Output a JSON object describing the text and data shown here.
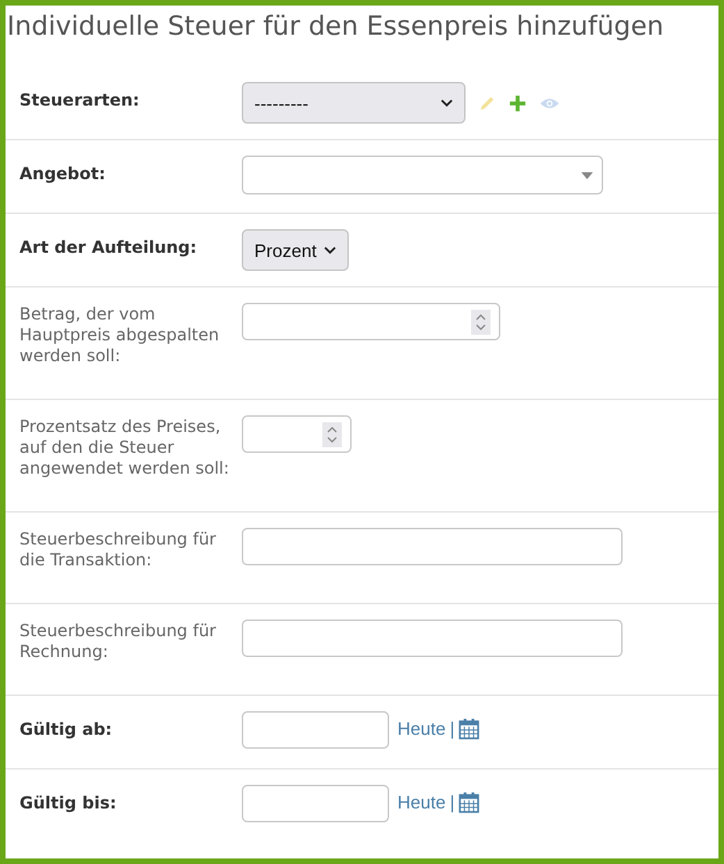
{
  "title": "Individuelle Steuer für den Essenpreis hinzufügen",
  "fields": [
    {
      "label": "Steuerarten:",
      "required": true,
      "kind": "select",
      "value": "---------",
      "actions": true
    },
    {
      "label": "Angebot:",
      "required": true,
      "kind": "combo"
    },
    {
      "label": "Art der Aufteilung:",
      "required": true,
      "kind": "small-select",
      "value": "Prozent"
    },
    {
      "label": "Betrag, der vom Hauptpreis abgespalten werden soll:",
      "required": false,
      "kind": "number"
    },
    {
      "label": "Prozentsatz des Preises, auf den die Steuer angewendet werden soll:",
      "required": false,
      "kind": "small-number"
    },
    {
      "label": "Steuerbeschreibung für die Transaktion:",
      "required": false,
      "kind": "text"
    },
    {
      "label": "Steuerbeschreibung für Rechnung:",
      "required": false,
      "kind": "text"
    },
    {
      "label": "Gültig ab:",
      "required": true,
      "kind": "date",
      "today": "Heute",
      "separator": "|"
    },
    {
      "label": "Gültig bis:",
      "required": true,
      "kind": "date",
      "today": "Heute",
      "separator": "|"
    }
  ]
}
